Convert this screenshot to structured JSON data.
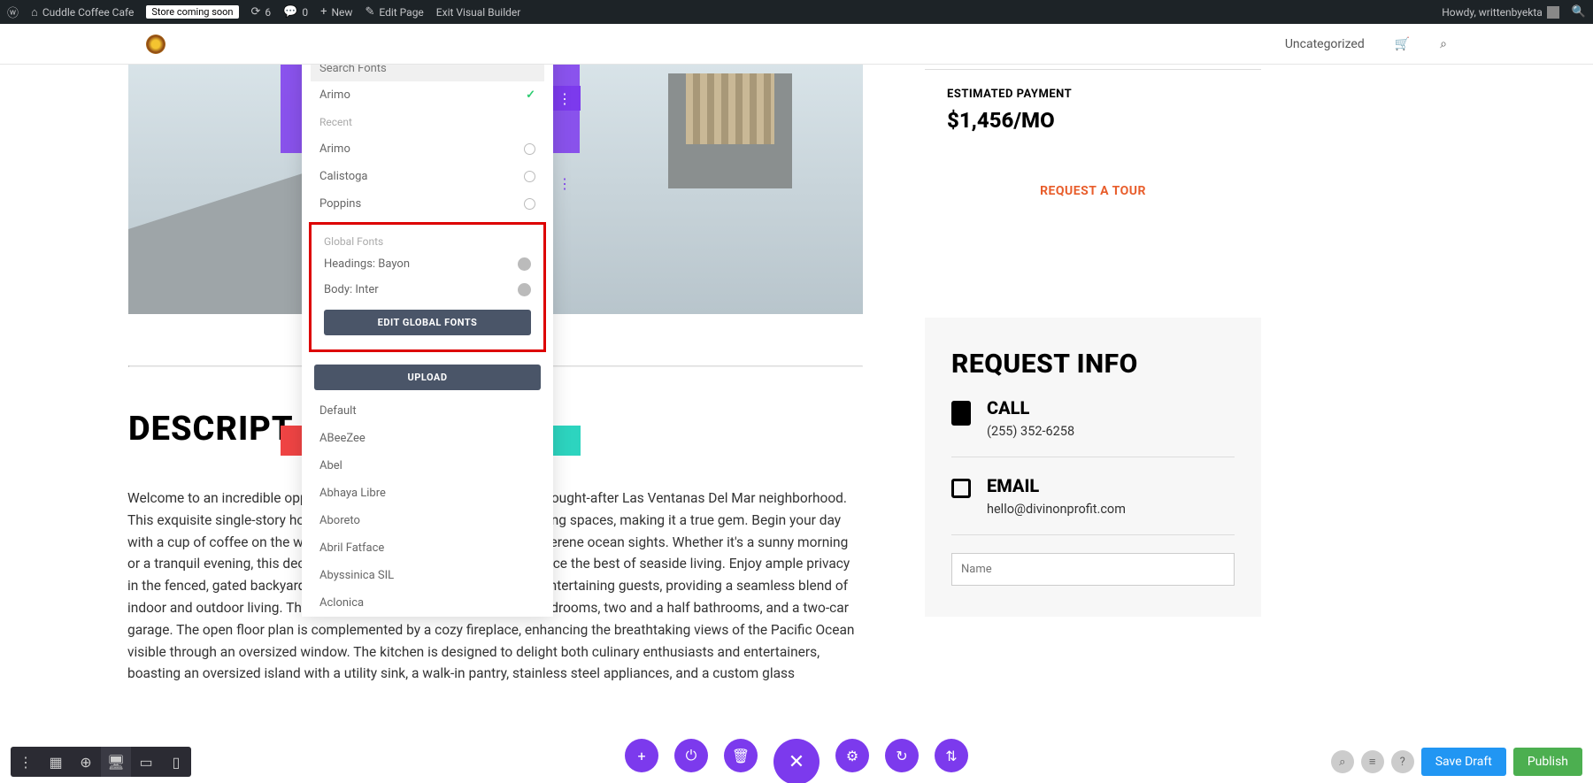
{
  "admin_bar": {
    "site_name": "Cuddle Coffee Cafe",
    "store_badge": "Store coming soon",
    "refresh_count": "6",
    "comments_count": "0",
    "new_label": "New",
    "edit_page": "Edit Page",
    "exit_vb": "Exit Visual Builder",
    "howdy": "Howdy, writtenbyekta"
  },
  "nav": {
    "uncategorized": "Uncategorized"
  },
  "font_panel": {
    "search_placeholder": "Search Fonts",
    "selected": "Arimo",
    "recent_label": "Recent",
    "recent": [
      "Arimo",
      "Calistoga",
      "Poppins"
    ],
    "global_label": "Global Fonts",
    "global_headings": "Headings: Bayon",
    "global_body": "Body: Inter",
    "edit_global_btn": "EDIT GLOBAL FONTS",
    "upload_btn": "UPLOAD",
    "all_fonts": [
      "Default",
      "ABeeZee",
      "Abel",
      "Abhaya Libre",
      "Aboreto",
      "Abril Fatface",
      "Abyssinica SIL",
      "Aclonica"
    ]
  },
  "page": {
    "desc_heading": "DESCRIPT",
    "desc_text": "Welcome to an incredible opportunity to own a property in the highly sought-after Las Ventanas Del Mar neighborhood. This exquisite single-story home offers ocean views throughout its living spaces, making it a true gem. Begin your day with a cup of coffee on the wrap-around deck, where you can take in serene ocean sights. Whether it's a sunny morning or a tranquil evening, this deck provides the perfect setting to experience the best of seaside living. Enjoy ample privacy in the fenced, gated backyard. The backyard is perfect for BBQs and entertaining guests, providing a seamless blend of indoor and outdoor living. This home encompasses three spacious bedrooms, two and a half bathrooms, and a two-car garage. The open floor plan is complemented by a cozy fireplace, enhancing the breathtaking views of the Pacific Ocean visible through an oversized window. The kitchen is designed to delight both culinary enthusiasts and entertainers, boasting an oversized island with a utility sink, a walk-in pantry, stainless steel appliances, and a custom glass",
    "estimated_label": "ESTIMATED PAYMENT",
    "estimated_value": "$1,456/MO",
    "request_tour": "REQUEST A TOUR",
    "request_info": "REQUEST INFO",
    "call_label": "CALL",
    "call_value": "(255) 352-6258",
    "email_label": "EMAIL",
    "email_value": "hello@divinonprofit.com",
    "name_placeholder": "Name"
  },
  "bottom_bar": {
    "save_draft": "Save Draft",
    "publish": "Publish"
  }
}
